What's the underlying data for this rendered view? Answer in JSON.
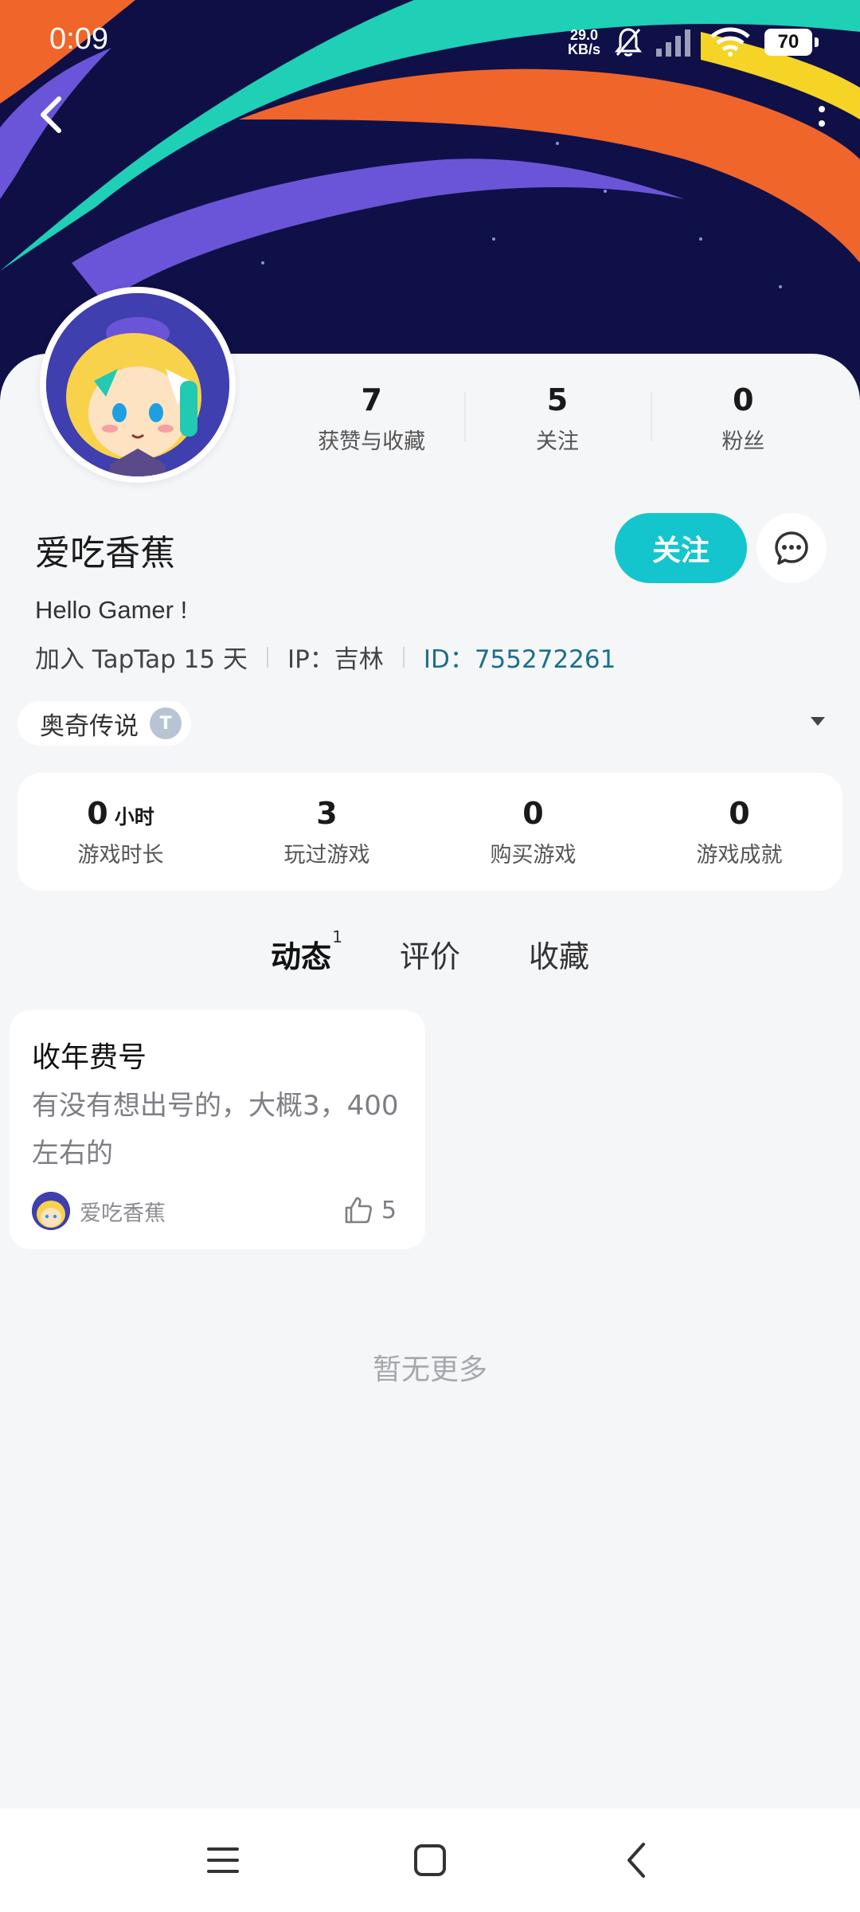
{
  "status_bar": {
    "time": "0:09",
    "net_speed_value": "29.0",
    "net_speed_unit": "KB/s",
    "battery": "70"
  },
  "profile": {
    "username": "爱吃香蕉",
    "bio": "Hello Gamer !",
    "join_text": "加入 TapTap 15 天",
    "ip_text": "IP：吉林",
    "id_label": "ID：",
    "id_value": "755272261",
    "follow_label": "关注"
  },
  "top_stats": [
    {
      "value": "7",
      "label": "获赞与收藏"
    },
    {
      "value": "5",
      "label": "关注"
    },
    {
      "value": "0",
      "label": "粉丝"
    }
  ],
  "game_tag": {
    "label": "奥奇传说",
    "badge": "T"
  },
  "game_stats": [
    {
      "value": "0",
      "unit": "小时",
      "label": "游戏时长"
    },
    {
      "value": "3",
      "unit": "",
      "label": "玩过游戏"
    },
    {
      "value": "0",
      "unit": "",
      "label": "购买游戏"
    },
    {
      "value": "0",
      "unit": "",
      "label": "游戏成就"
    }
  ],
  "tabs": [
    {
      "label": "动态",
      "badge": "1",
      "active": true
    },
    {
      "label": "评价",
      "badge": "",
      "active": false
    },
    {
      "label": "收藏",
      "badge": "",
      "active": false
    }
  ],
  "post": {
    "title": "收年费号",
    "body": "有没有想出号的，大概3，400左右的",
    "author": "爱吃香蕉",
    "likes": "5"
  },
  "footer_text": "暂无更多",
  "colors": {
    "accent": "#15c5ce",
    "id_link": "#1d6f8c",
    "banner_bg": "#101048"
  }
}
